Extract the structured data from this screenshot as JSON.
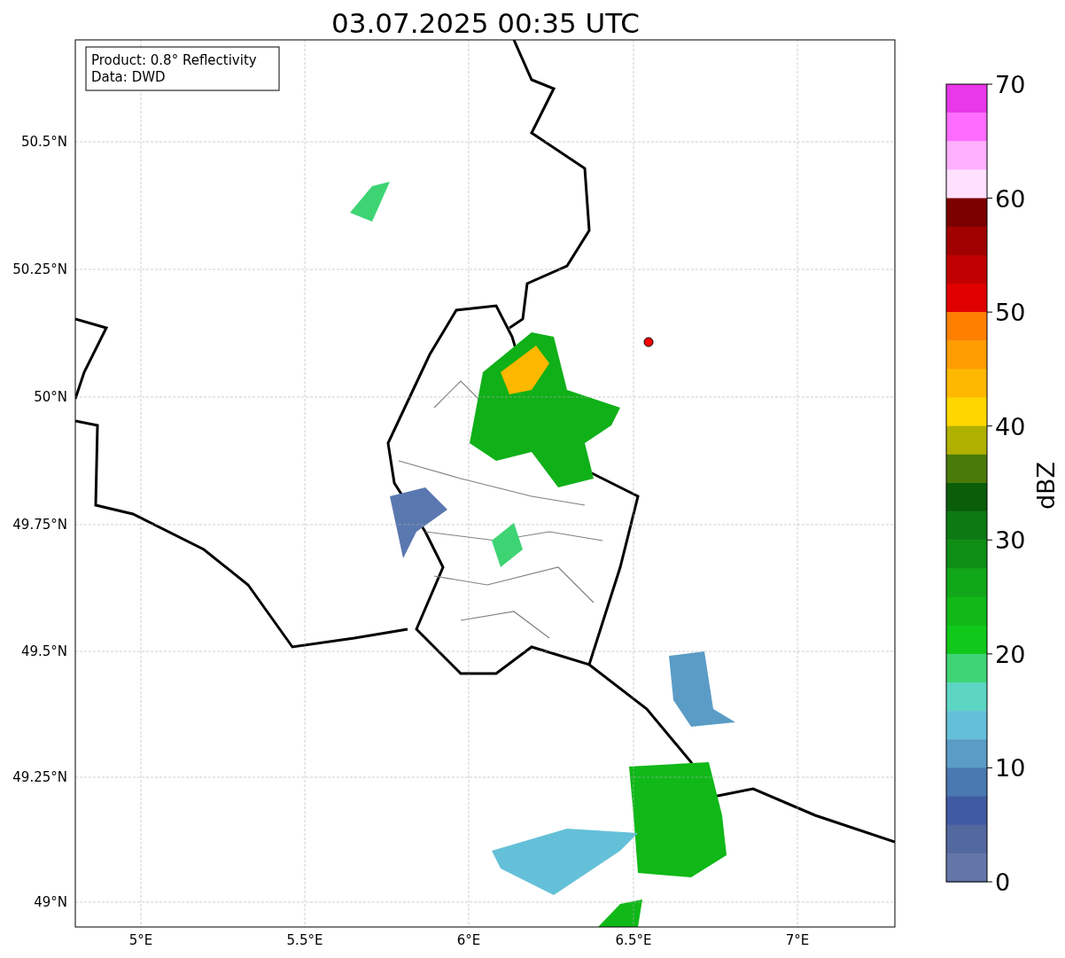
{
  "title": "03.07.2025 00:35 UTC",
  "legend": {
    "lines": [
      "Product: 0.8° Reflectivity",
      "Data: DWD"
    ]
  },
  "map": {
    "y_ticks": [
      "50.5°N",
      "50.25°N",
      "50°N",
      "49.75°N",
      "49.5°N",
      "49.25°N",
      "49°N"
    ],
    "x_ticks": [
      "5°E",
      "5.5°E",
      "6°E",
      "6.5°E",
      "7°E"
    ]
  },
  "colorbar": {
    "label": "dBZ",
    "ticks": [
      "70",
      "60",
      "50",
      "40",
      "30",
      "20",
      "10",
      "0"
    ],
    "bins": [
      {
        "color": "#e838e8"
      },
      {
        "color": "#ff6cff"
      },
      {
        "color": "#ffb0ff"
      },
      {
        "color": "#ffe0ff"
      },
      {
        "color": "#7a0000"
      },
      {
        "color": "#a00000"
      },
      {
        "color": "#c00000"
      },
      {
        "color": "#e00000"
      },
      {
        "color": "#ff7f00"
      },
      {
        "color": "#ff9c00"
      },
      {
        "color": "#ffb800"
      },
      {
        "color": "#ffd700"
      },
      {
        "color": "#b0b000"
      },
      {
        "color": "#4a7a0a"
      },
      {
        "color": "#0a5e0a"
      },
      {
        "color": "#0c7a12"
      },
      {
        "color": "#0e8e14"
      },
      {
        "color": "#10a818"
      },
      {
        "color": "#10b818"
      },
      {
        "color": "#10c81a"
      },
      {
        "color": "#3ed474"
      },
      {
        "color": "#5cd6c2"
      },
      {
        "color": "#64c0d8"
      },
      {
        "color": "#5a9cc6"
      },
      {
        "color": "#4a78b0"
      },
      {
        "color": "#415ba3"
      },
      {
        "color": "#5468a0"
      },
      {
        "color": "#6475a8"
      }
    ]
  }
}
